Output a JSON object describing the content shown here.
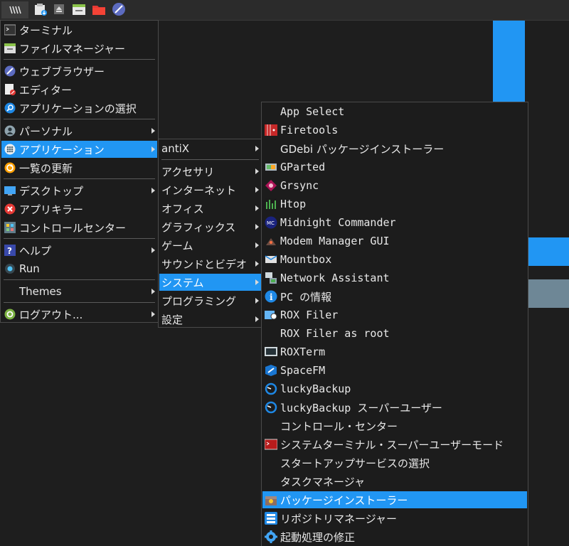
{
  "colors": {
    "accent": "#2196f3",
    "menu_bg": "#1c1c1c",
    "taskbar_bg": "#2b2b2b"
  },
  "taskbar": {
    "menu_button_icon": "antix-menu-icon",
    "launchers": [
      "install-icon",
      "eject-icon",
      "file-manager-icon",
      "folder-icon",
      "web-browser-icon"
    ]
  },
  "main_menu": {
    "items": [
      {
        "label": "ターミナル",
        "icon": "terminal-icon"
      },
      {
        "label": "ファイルマネージャー",
        "icon": "file-manager-icon"
      },
      {
        "label": "ウェブブラウザー",
        "icon": "web-browser-icon"
      },
      {
        "label": "エディター",
        "icon": "editor-icon"
      },
      {
        "label": "アプリケーションの選択",
        "icon": "app-select-icon"
      },
      {
        "label": "パーソナル",
        "icon": "user-icon"
      },
      {
        "label": "アプリケーション",
        "icon": "applications-icon"
      },
      {
        "label": "一覧の更新",
        "icon": "refresh-icon"
      },
      {
        "label": "デスクトップ",
        "icon": "desktop-icon"
      },
      {
        "label": "アプリキラー",
        "icon": "app-killer-icon"
      },
      {
        "label": "コントロールセンター",
        "icon": "control-center-icon"
      },
      {
        "label": "ヘルプ",
        "icon": "help-icon"
      },
      {
        "label": "Run",
        "icon": "run-icon"
      },
      {
        "label": "Themes",
        "icon": ""
      },
      {
        "label": "ログアウト...",
        "icon": "logout-icon"
      }
    ]
  },
  "apps_menu": {
    "items": [
      {
        "label": "antiX"
      },
      {
        "label": "アクセサリ"
      },
      {
        "label": "インターネット"
      },
      {
        "label": "オフィス"
      },
      {
        "label": "グラフィックス"
      },
      {
        "label": "ゲーム"
      },
      {
        "label": "サウンドとビデオ"
      },
      {
        "label": "システム"
      },
      {
        "label": "プログラミング"
      },
      {
        "label": "設定"
      }
    ]
  },
  "system_menu": {
    "items": [
      {
        "label": "App Select",
        "icon": ""
      },
      {
        "label": "Firetools",
        "icon": "firetools-icon"
      },
      {
        "label": "GDebi パッケージインストーラー",
        "icon": ""
      },
      {
        "label": "GParted",
        "icon": "gparted-icon"
      },
      {
        "label": "Grsync",
        "icon": "grsync-icon"
      },
      {
        "label": "Htop",
        "icon": "htop-icon"
      },
      {
        "label": "Midnight Commander",
        "icon": "midnight-commander-icon"
      },
      {
        "label": "Modem Manager GUI",
        "icon": "modem-manager-icon"
      },
      {
        "label": "Mountbox",
        "icon": "mountbox-icon"
      },
      {
        "label": "Network Assistant",
        "icon": "network-assistant-icon"
      },
      {
        "label": "PC の情報",
        "icon": "info-icon"
      },
      {
        "label": "ROX Filer",
        "icon": "rox-filer-icon"
      },
      {
        "label": "ROX Filer as root",
        "icon": ""
      },
      {
        "label": "ROXTerm",
        "icon": "roxterm-icon"
      },
      {
        "label": "SpaceFM",
        "icon": "spacefm-icon"
      },
      {
        "label": "luckyBackup",
        "icon": "luckybackup-icon"
      },
      {
        "label": "luckyBackup スーパーユーザー",
        "icon": "luckybackup-icon"
      },
      {
        "label": "コントロール・センター",
        "icon": ""
      },
      {
        "label": "システムターミナル・スーパーユーザーモード",
        "icon": "root-terminal-icon"
      },
      {
        "label": "スタートアップサービスの選択",
        "icon": ""
      },
      {
        "label": "タスクマネージャ",
        "icon": ""
      },
      {
        "label": "パッケージインストーラー",
        "icon": "package-installer-icon"
      },
      {
        "label": "リポジトリマネージャー",
        "icon": "repo-manager-icon"
      },
      {
        "label": "起動処理の修正",
        "icon": "boot-repair-icon"
      }
    ]
  }
}
